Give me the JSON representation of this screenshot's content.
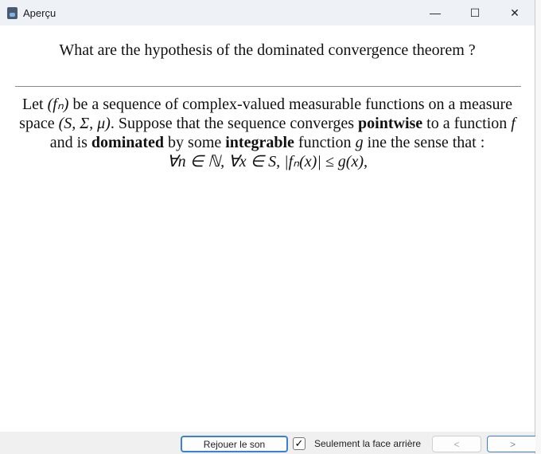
{
  "window": {
    "title": "Aperçu",
    "minimize": "—",
    "maximize": "☐",
    "close": "✕"
  },
  "card": {
    "question": "What are the hypothesis of the dominated convergence theorem ?",
    "answer": {
      "s1": "Let ",
      "m1": "(fₙ)",
      "s2": " be a sequence of complex-valued measurable functions on a measure space ",
      "m2": "(S, Σ, μ)",
      "s3": ". Suppose that the sequence converges ",
      "b1": "pointwise",
      "s4": " to a function ",
      "m3": "f",
      "s5": " and is ",
      "b2": "dominated",
      "s6": " by some ",
      "b3": "integrable",
      "s7": " function ",
      "m4": "g",
      "s8": " ine the sense that :",
      "formula": "∀n ∈ ℕ, ∀x ∈ S, |fₙ(x)| ≤ g(x),"
    }
  },
  "footer": {
    "replay": "Rejouer le son",
    "back_only_label": "Seulement la face arrière",
    "back_only_checked": true,
    "check": "✓",
    "prev": "<",
    "next": ">"
  }
}
